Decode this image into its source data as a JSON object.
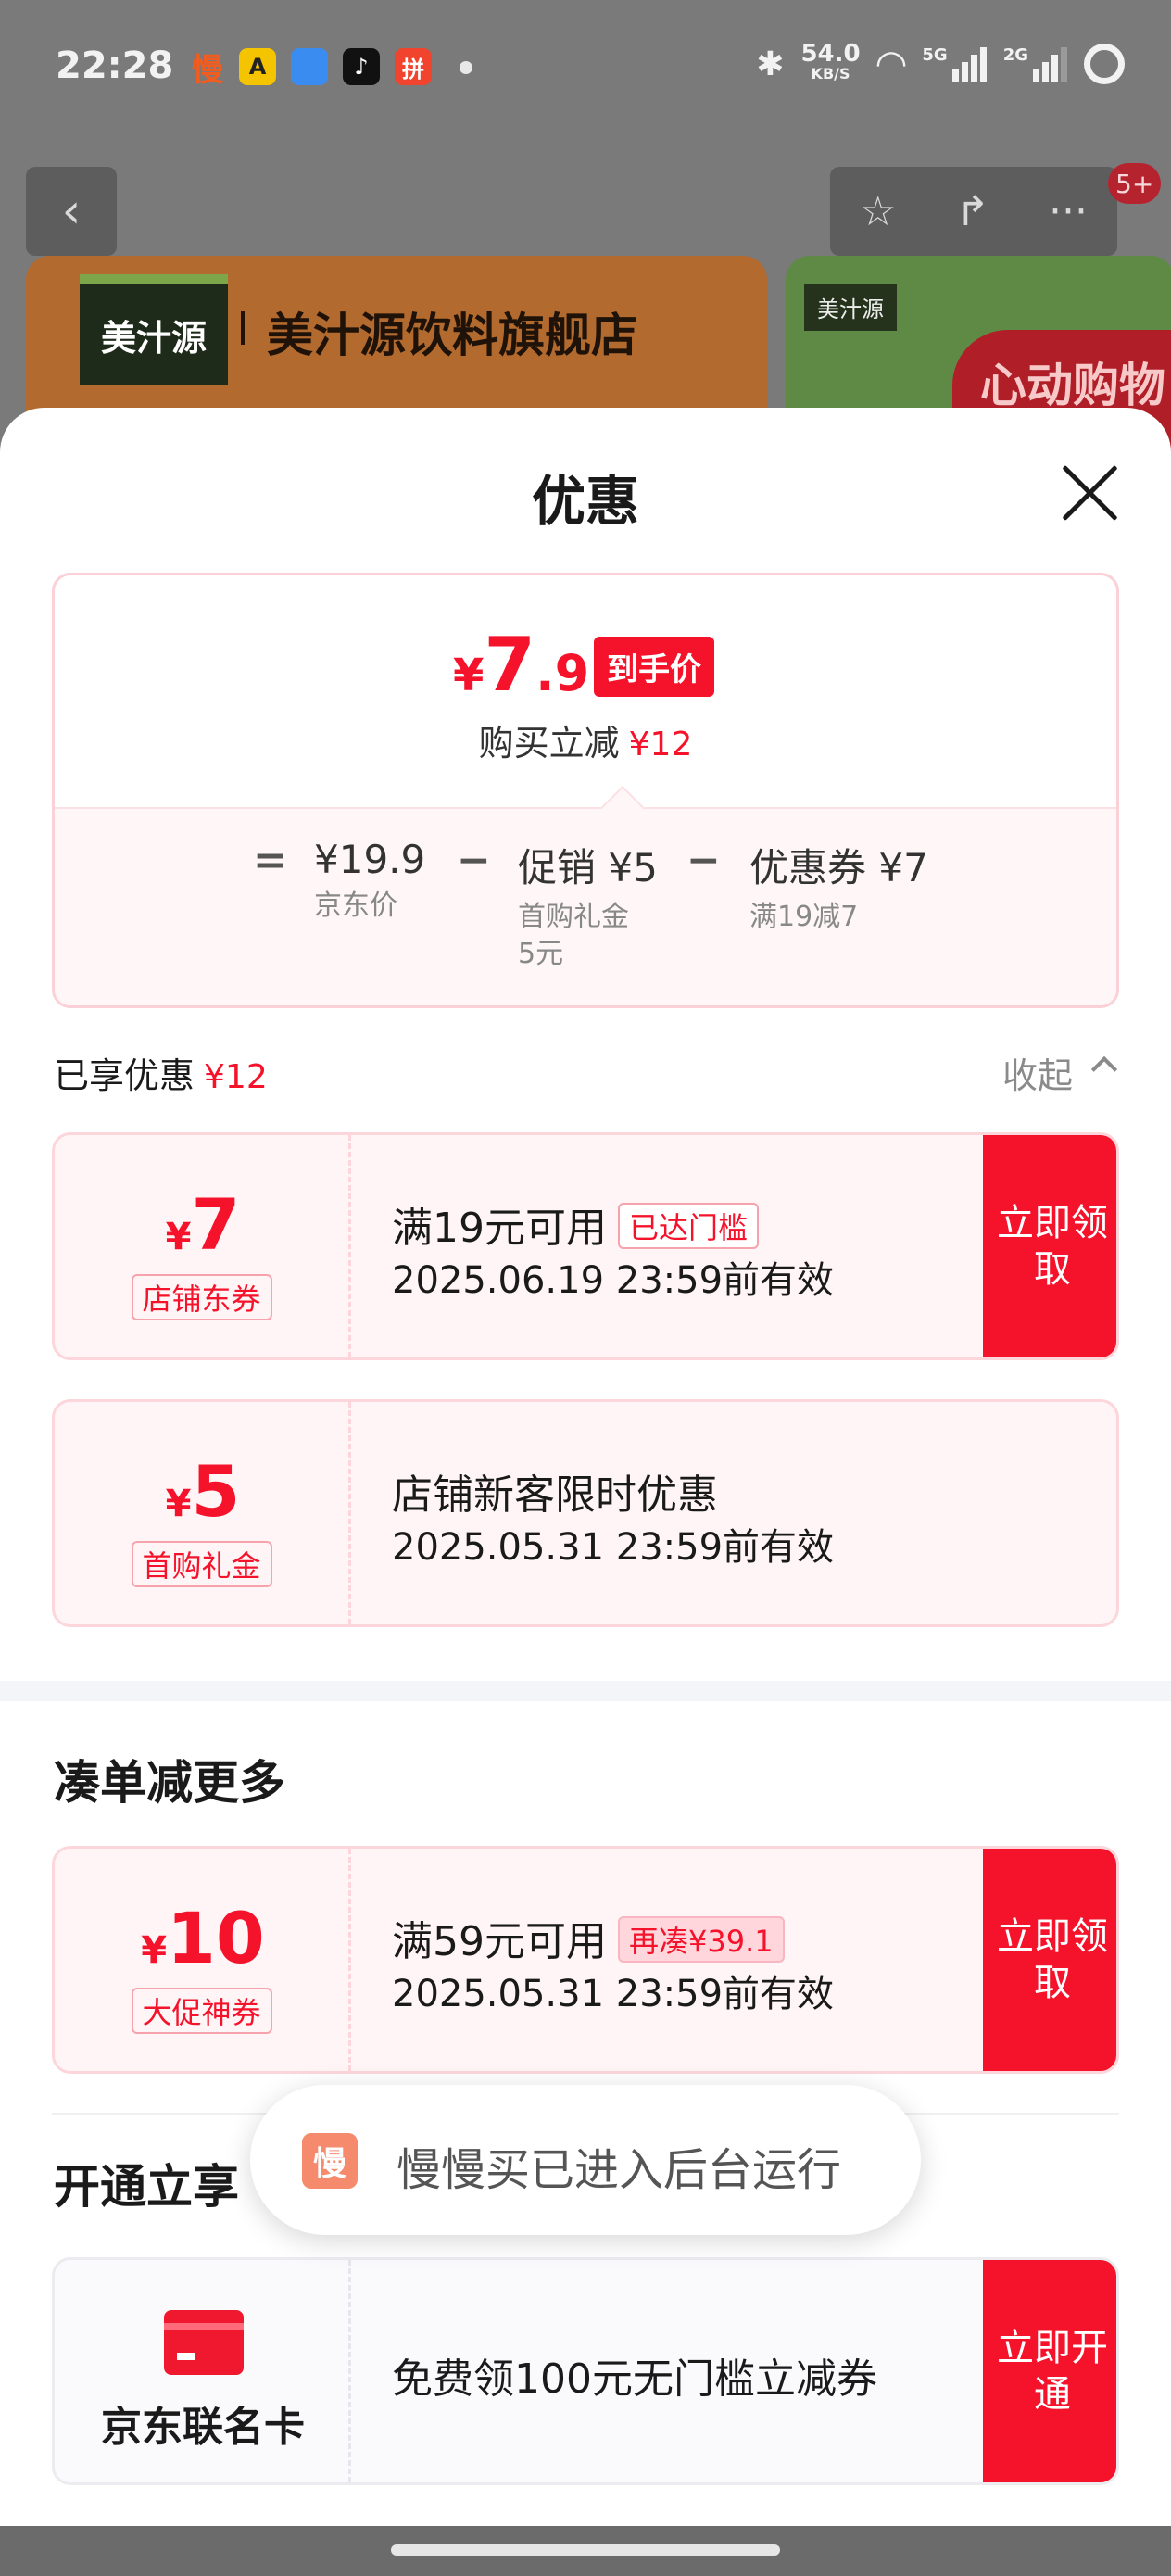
{
  "status_bar": {
    "time": "22:28",
    "apps": [
      {
        "icon": "manman-app-icon",
        "glyph": "慢",
        "color": "#f25c1e"
      },
      {
        "icon": "meituan-app-icon",
        "glyph": "A",
        "color": "#f5c400"
      },
      {
        "icon": "blue-app-icon",
        "glyph": "",
        "color": "#3b8cf0"
      },
      {
        "icon": "tiktok-app-icon",
        "glyph": "♪",
        "color": "#111111"
      },
      {
        "icon": "pdd-app-icon",
        "glyph": "拼",
        "color": "#f0442e"
      }
    ],
    "net_speed": "54.0",
    "net_unit": "KB/S",
    "sim1": "5G",
    "sim2": "2G"
  },
  "background": {
    "badge": "5+",
    "store_logo": "美汁源",
    "store_name": "美汁源饮料旗舰店",
    "promo_logo": "美汁源",
    "promo_text": "心动购物季"
  },
  "sheet": {
    "title": "优惠",
    "summary": {
      "currency": "¥",
      "price_int": "7",
      "price_dec": ".9",
      "price_tag": "到手价",
      "reduce_label": "购买立减",
      "reduce_amount": "¥12",
      "breakdown": [
        {
          "op": "=",
          "value": "¥19.9",
          "sub": "京东价"
        },
        {
          "op": "−",
          "value": "促销 ¥5",
          "sub": "首购礼金\n5元"
        },
        {
          "op": "−",
          "value": "优惠券 ¥7",
          "sub": "满19减7"
        }
      ]
    },
    "applied": {
      "label": "已享优惠",
      "amount": "¥12",
      "collapse": "收起"
    },
    "coupons": [
      {
        "currency": "¥",
        "amount": "7",
        "tag": "店铺东券",
        "condition": "满19元可用",
        "status": "已达门槛",
        "expiry": "2025.06.19 23:59前有效",
        "action": "立即领取"
      },
      {
        "currency": "¥",
        "amount": "5",
        "tag": "首购礼金",
        "condition": "店铺新客限时优惠",
        "status": "",
        "expiry": "2025.05.31 23:59前有效",
        "action": ""
      }
    ],
    "more_section": {
      "title": "凑单减更多",
      "coupon": {
        "currency": "¥",
        "amount": "10",
        "tag": "大促神券",
        "condition": "满59元可用",
        "status": "再凑¥39.1",
        "expiry": "2025.05.31 23:59前有效",
        "action": "立即领取"
      }
    },
    "open_section": {
      "title": "开通立享",
      "card_label": "京东联名卡",
      "card_text": "免费领100元无门槛立减券",
      "action": "立即开通"
    }
  },
  "toast": {
    "icon_glyph": "慢",
    "text": "慢慢买已进入后台运行"
  },
  "colors": {
    "accent_red": "#f5132b",
    "coupon_bg": "#fff5f6",
    "dim_bg": "#7a7a7a"
  }
}
